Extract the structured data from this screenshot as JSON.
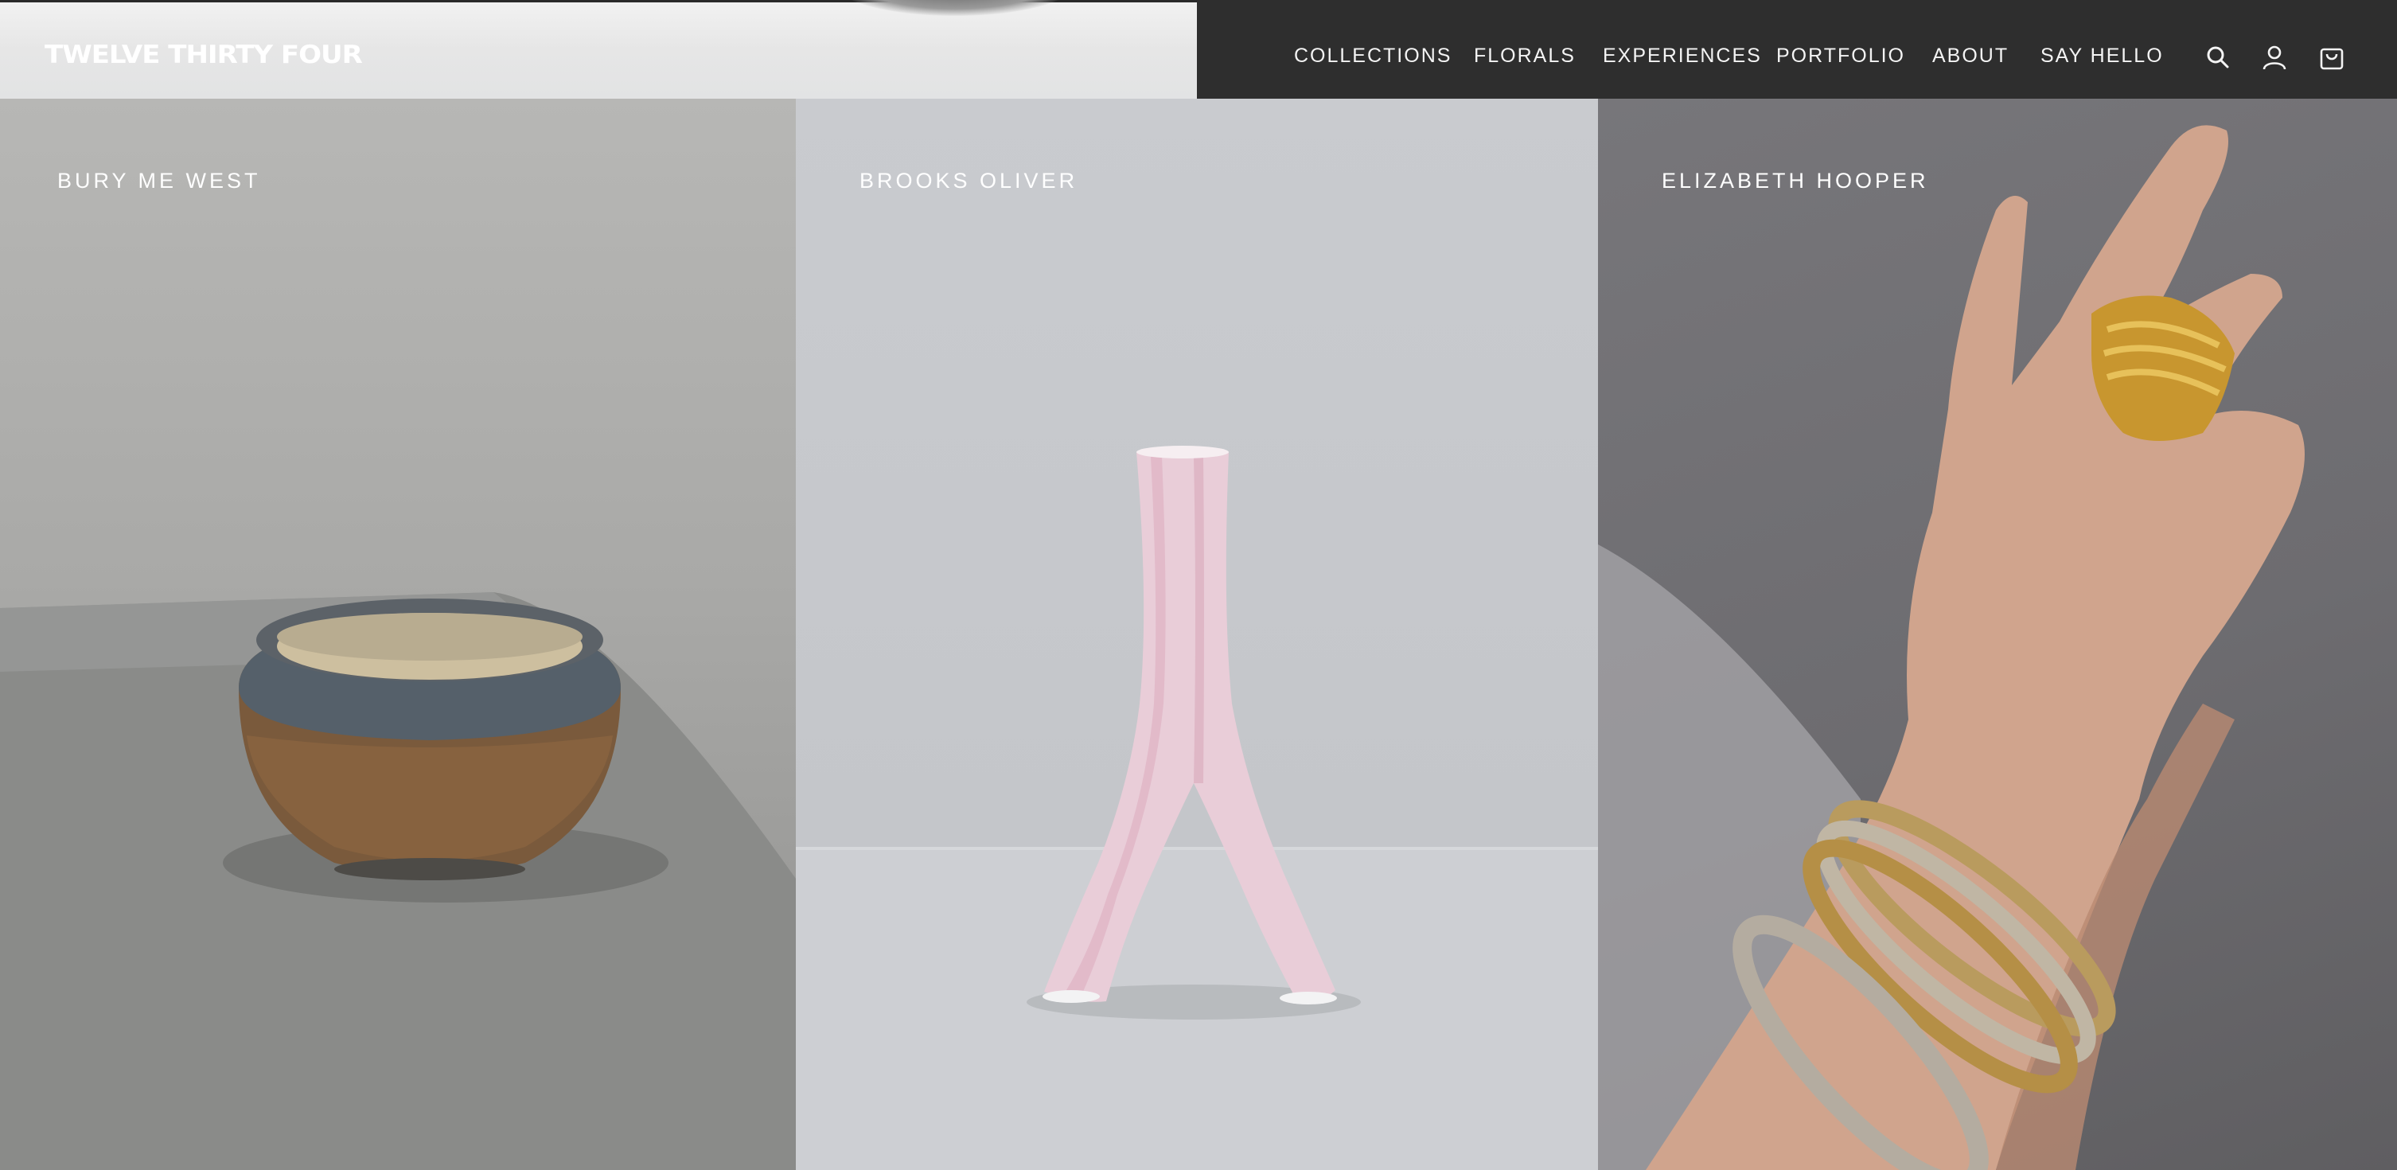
{
  "brand": {
    "logo_text": "TWELVE THIRTY FOUR"
  },
  "nav": {
    "items": [
      {
        "label": "COLLECTIONS"
      },
      {
        "label": "FLORALS"
      },
      {
        "label": "EXPERIENCES"
      },
      {
        "label": "PORTFOLIO"
      },
      {
        "label": "ABOUT"
      },
      {
        "label": "SAY HELLO"
      }
    ],
    "icons": [
      "search-icon",
      "account-icon",
      "cart-icon"
    ]
  },
  "panels": [
    {
      "label": "BURY ME WEST",
      "image": "textured-ceramic-bowl"
    },
    {
      "label": "BROOKS OLIVER",
      "image": "pink-forked-vase"
    },
    {
      "label": "ELIZABETH HOOPER",
      "image": "hand-with-gold-ring-and-bangles"
    }
  ],
  "colors": {
    "header_dark": "#2e2e2e",
    "nav_text": "#f4f4f4",
    "panel_label": "#ffffff"
  }
}
